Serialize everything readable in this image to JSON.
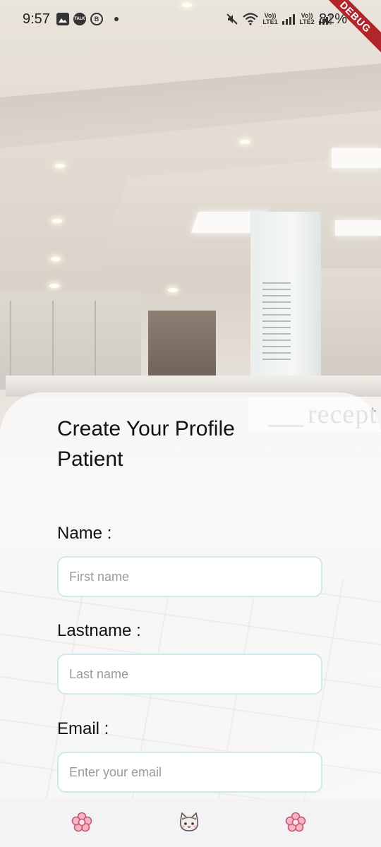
{
  "status_bar": {
    "time": "9:57",
    "left_icons": [
      "image-icon",
      "talk-icon",
      "b-icon",
      "dot-icon"
    ],
    "talk_label": "TALK",
    "b_label": "B",
    "right_icons": [
      "mute-icon",
      "wifi-icon",
      "volte1-signal-icon",
      "volte2-signal-icon",
      "battery-icon"
    ],
    "lte1_label": "Vo)) LTE1",
    "lte2_label": "Vo)) LTE2",
    "battery": "82%"
  },
  "debug_banner": "DEBUG",
  "background_sign": "recept",
  "form": {
    "title": "Create Your Profile Patient",
    "fields": [
      {
        "label": "Name :",
        "placeholder": "First name",
        "value": ""
      },
      {
        "label": "Lastname :",
        "placeholder": "Last name",
        "value": ""
      },
      {
        "label": "Email :",
        "placeholder": "Enter your email",
        "value": ""
      }
    ]
  },
  "bottom_nav": {
    "items": [
      {
        "icon": "flower-icon",
        "color": "#e98aa4"
      },
      {
        "icon": "cat-icon",
        "color": "#8a7f7a"
      },
      {
        "icon": "flower-icon",
        "color": "#e98aa4"
      }
    ]
  },
  "colors": {
    "input_border": "#cfe9ef",
    "debug_ribbon": "#b0262a",
    "nav_background": "#f3f2f5"
  }
}
